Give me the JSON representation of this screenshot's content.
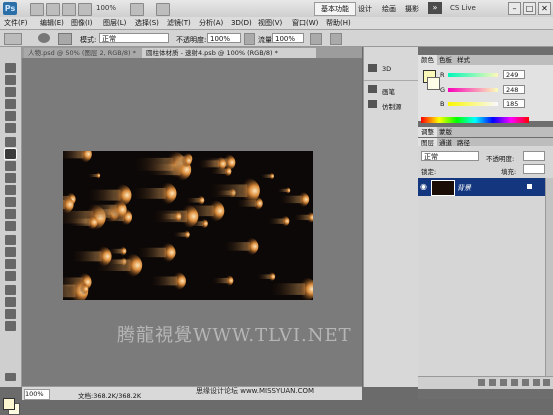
{
  "app": {
    "logo_text": "Ps",
    "zoom": "100%",
    "workspaces": [
      "基本功能",
      "设计",
      "绘画",
      "摄影"
    ],
    "more_label": "»",
    "cs_live": "CS Live",
    "window_controls": [
      "–",
      "□",
      "✕"
    ]
  },
  "menubar": {
    "items": [
      "文件(F)",
      "编辑(E)",
      "图像(I)",
      "图层(L)",
      "选择(S)",
      "滤镜(T)",
      "分析(A)",
      "3D(D)",
      "视图(V)",
      "窗口(W)",
      "帮助(H)"
    ]
  },
  "options": {
    "mode_label": "模式:",
    "mode_value": "正常",
    "opacity_label": "不透明度:",
    "opacity_value": "100%",
    "flow_label": "流量:",
    "flow_value": "100%"
  },
  "tabs": [
    {
      "label": "人物.psd @ 50% (图层 2, RGB/8) *",
      "active": false
    },
    {
      "label": "圆柱体材质 - 速射4.psb @ 100% (RGB/8) *",
      "active": true
    }
  ],
  "status": {
    "zoom": "100%",
    "doc_info": "文档:368.2K/368.2K"
  },
  "watermark": "腾龍視覺WWW.TLVI.NET",
  "site_credit": "思缘设计论坛  www.MISSYUAN.COM",
  "strip": {
    "items": [
      "3D",
      "画笔",
      "仿制源"
    ]
  },
  "color_panel": {
    "tabs": [
      "颜色",
      "色板",
      "样式"
    ],
    "channels": [
      {
        "label": "R",
        "value": "249"
      },
      {
        "label": "G",
        "value": "248"
      },
      {
        "label": "B",
        "value": "185"
      }
    ],
    "foreground": "#f9f8b9"
  },
  "adjust_tabs": [
    "调整",
    "蒙版"
  ],
  "layers_panel": {
    "tabs": [
      "图层",
      "通道",
      "路径"
    ],
    "blend_mode": "正常",
    "opacity_label": "不透明度:",
    "lock_label": "锁定:",
    "fill_label": "填充:",
    "layer_name": "背景"
  }
}
